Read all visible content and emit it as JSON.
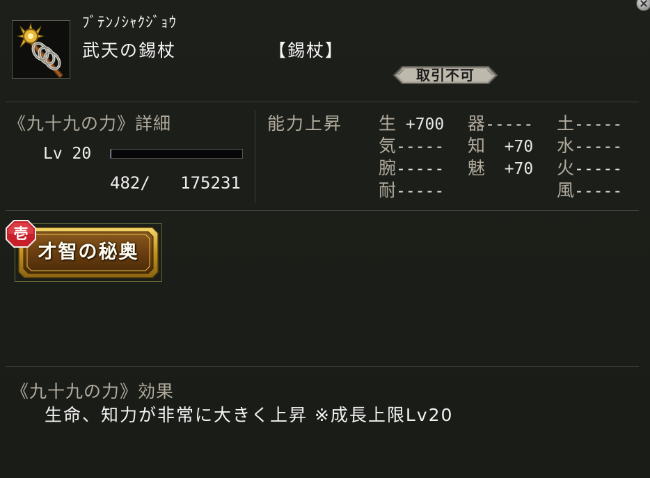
{
  "item": {
    "reading": "ﾌﾞﾃﾝﾉｼｬｸｼﾞｮｳ",
    "name": "武天の錫杖",
    "type": "【錫杖】",
    "trade_status": "取引不可",
    "icon": "staff-icon"
  },
  "detail": {
    "title": "《九十九の力》詳細",
    "level_label": "Lv 20",
    "xp_text": "482/   175231",
    "xp_fraction": 0.003
  },
  "abilities": {
    "header": "能力上昇",
    "stats": [
      {
        "name": "生",
        "value": " +700"
      },
      {
        "name": "器",
        "value": "-----"
      },
      {
        "name": "土",
        "value": "-----"
      },
      {
        "name": "気",
        "value": "-----"
      },
      {
        "name": "知",
        "value": "  +70"
      },
      {
        "name": "水",
        "value": "-----"
      },
      {
        "name": "腕",
        "value": "-----"
      },
      {
        "name": "魅",
        "value": "  +70"
      },
      {
        "name": "火",
        "value": "-----"
      },
      {
        "name": "耐",
        "value": "-----"
      },
      {
        "name": "風",
        "value": "-----"
      }
    ]
  },
  "skill": {
    "rank": "壱",
    "name": "才智の秘奥"
  },
  "effect": {
    "title": "《九十九の力》効果",
    "description": "生命、知力が非常に大きく上昇 ※成長上限Lv20"
  },
  "colors": {
    "background": "#1b1d18",
    "label": "#b0ab9e",
    "text": "#eeeeee",
    "gold": "#c9a233",
    "badge_red": "#c8202a"
  }
}
